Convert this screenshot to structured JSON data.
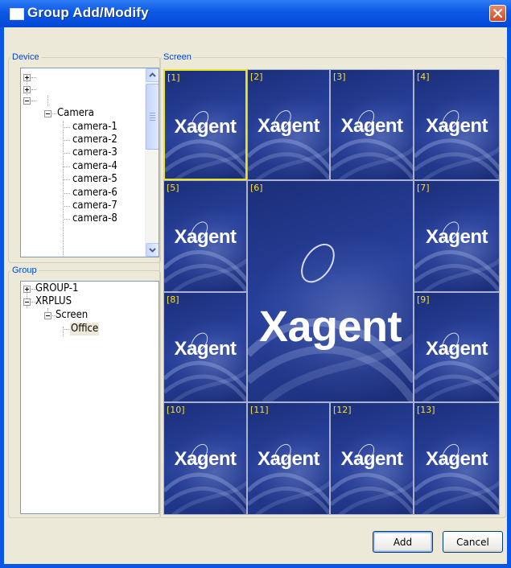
{
  "window": {
    "title": "Group Add/Modify"
  },
  "device": {
    "legend": "Device",
    "nodes": [
      {
        "label": ""
      },
      {
        "label": ""
      },
      {
        "label": ""
      },
      {
        "label": "Camera"
      },
      {
        "label": "camera-1"
      },
      {
        "label": "camera-2"
      },
      {
        "label": "camera-3"
      },
      {
        "label": "camera-4"
      },
      {
        "label": "camera-5"
      },
      {
        "label": "camera-6"
      },
      {
        "label": "camera-7"
      },
      {
        "label": "camera-8"
      }
    ]
  },
  "group": {
    "legend": "Group",
    "nodes": [
      {
        "label": "GROUP-1"
      },
      {
        "label": "XRPLUS"
      },
      {
        "label": "Screen"
      },
      {
        "label": "Office"
      }
    ]
  },
  "screen": {
    "legend": "Screen",
    "logo_text": "Xagent",
    "cells": [
      {
        "label": "[1]"
      },
      {
        "label": "[2]"
      },
      {
        "label": "[3]"
      },
      {
        "label": "[4]"
      },
      {
        "label": "[5]"
      },
      {
        "label": "[6]"
      },
      {
        "label": "[7]"
      },
      {
        "label": "[8]"
      },
      {
        "label": "[9]"
      },
      {
        "label": "[10]"
      },
      {
        "label": "[11]"
      },
      {
        "label": "[12]"
      },
      {
        "label": "[13]"
      }
    ],
    "selected_cell": "[1]"
  },
  "buttons": {
    "add": "Add",
    "cancel": "Cancel"
  },
  "colors": {
    "title_bar": "#0b58e4",
    "dialog_bg": "#ece9d8",
    "screen_bg": "#1d2f73",
    "cell_label": "#f4e02a",
    "selected_border": "#e9e422"
  }
}
